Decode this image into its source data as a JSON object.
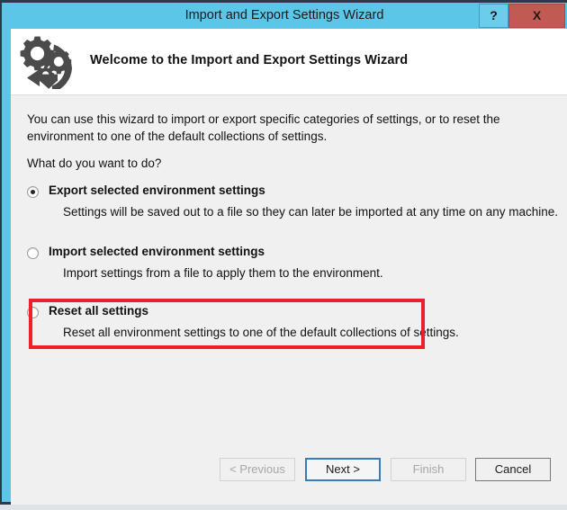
{
  "window": {
    "title": "Import and Export Settings Wizard",
    "help_label": "?",
    "close_label": "X",
    "accent_color": "#5bc6e8",
    "close_color": "#c05a53",
    "body_color": "#f0f0f0",
    "highlight_color": "#ec2028"
  },
  "header": {
    "icon": "gears-refresh-icon",
    "title": "Welcome to the Import and Export Settings Wizard"
  },
  "body": {
    "intro": "You can use this wizard to import or export specific categories of settings, or to reset the environment to one of the default collections of settings.",
    "question": "What do you want to do?"
  },
  "options": [
    {
      "id": "export",
      "label": "Export selected environment settings",
      "description": "Settings will be saved out to a file so they can later be imported at any time on any machine.",
      "selected": true,
      "highlighted": false
    },
    {
      "id": "import",
      "label": "Import selected environment settings",
      "description": "Import settings from a file to apply them to the environment.",
      "selected": false,
      "highlighted": false
    },
    {
      "id": "reset",
      "label": "Reset all settings",
      "description": "Reset all environment settings to one of the default collections of settings.",
      "selected": false,
      "highlighted": true
    }
  ],
  "footer": {
    "buttons": [
      {
        "id": "previous",
        "label": "< Previous",
        "state": "disabled"
      },
      {
        "id": "next",
        "label": "Next >",
        "state": "focused"
      },
      {
        "id": "finish",
        "label": "Finish",
        "state": "disabled"
      },
      {
        "id": "cancel",
        "label": "Cancel",
        "state": "default"
      }
    ]
  }
}
